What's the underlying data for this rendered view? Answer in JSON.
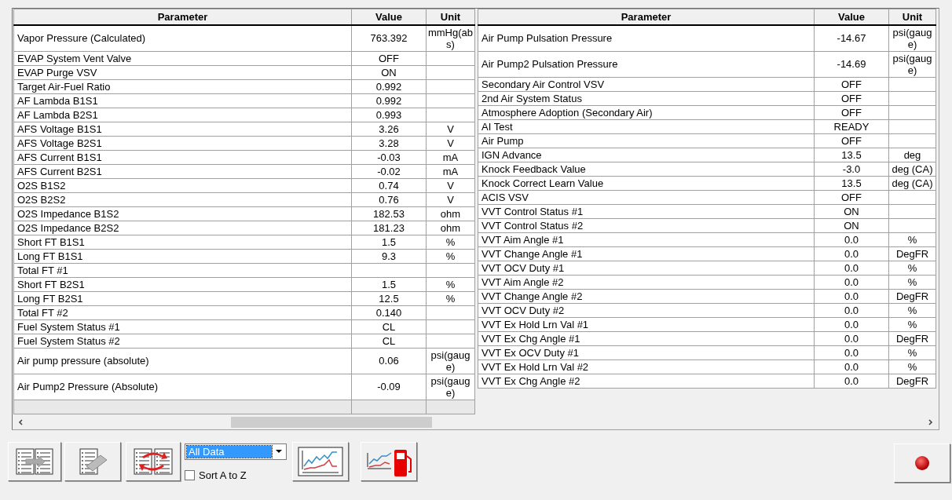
{
  "left_table": {
    "columns": [
      "Parameter",
      "Value",
      "Unit"
    ],
    "rows": [
      {
        "parameter": "Vapor Pressure (Calculated)",
        "value": "763.392",
        "unit": "mmHg(abs)"
      },
      {
        "parameter": "EVAP System Vent Valve",
        "value": "OFF"
      },
      {
        "parameter": "EVAP Purge VSV",
        "value": "ON"
      },
      {
        "parameter": "Target Air-Fuel Ratio",
        "value": "0.992"
      },
      {
        "parameter": "AF Lambda B1S1",
        "value": "0.992"
      },
      {
        "parameter": "AF Lambda B2S1",
        "value": "0.993"
      },
      {
        "parameter": "AFS Voltage B1S1",
        "value": "3.26",
        "unit": "V"
      },
      {
        "parameter": "AFS Voltage B2S1",
        "value": "3.28",
        "unit": "V"
      },
      {
        "parameter": "AFS Current B1S1",
        "value": "-0.03",
        "unit": "mA"
      },
      {
        "parameter": "AFS Current B2S1",
        "value": "-0.02",
        "unit": "mA"
      },
      {
        "parameter": "O2S B1S2",
        "value": "0.74",
        "unit": "V"
      },
      {
        "parameter": "O2S B2S2",
        "value": "0.76",
        "unit": "V"
      },
      {
        "parameter": "O2S Impedance B1S2",
        "value": "182.53",
        "unit": "ohm"
      },
      {
        "parameter": "O2S Impedance B2S2",
        "value": "181.23",
        "unit": "ohm"
      },
      {
        "parameter": "Short FT B1S1",
        "value": "1.5",
        "unit": "%"
      },
      {
        "parameter": "Long FT B1S1",
        "value": "9.3",
        "unit": "%"
      },
      {
        "parameter": "Total FT #1"
      },
      {
        "parameter": "Short FT B2S1",
        "value": "1.5",
        "unit": "%"
      },
      {
        "parameter": "Long FT B2S1",
        "value": "12.5",
        "unit": "%"
      },
      {
        "parameter": "Total FT #2",
        "value": "0.140"
      },
      {
        "parameter": "Fuel System Status #1",
        "value": "CL"
      },
      {
        "parameter": "Fuel System Status #2",
        "value": "CL"
      },
      {
        "parameter": "Air pump pressure (absolute)",
        "value": "0.06",
        "unit": "psi(gauge)"
      },
      {
        "parameter": "Air Pump2 Pressure (Absolute)",
        "value": "-0.09",
        "unit": "psi(gauge)"
      }
    ]
  },
  "right_table": {
    "columns": [
      "Parameter",
      "Value",
      "Unit"
    ],
    "rows": [
      {
        "parameter": "Air Pump Pulsation Pressure",
        "value": "-14.67",
        "unit": "psi(gauge)"
      },
      {
        "parameter": "Air Pump2 Pulsation Pressure",
        "value": "-14.69",
        "unit": "psi(gauge)"
      },
      {
        "parameter": "Secondary Air Control VSV",
        "value": "OFF"
      },
      {
        "parameter": "2nd Air System Status",
        "value": "OFF"
      },
      {
        "parameter": "Atmosphere Adoption (Secondary Air)",
        "value": "OFF"
      },
      {
        "parameter": "AI Test",
        "value": "READY"
      },
      {
        "parameter": "Air Pump",
        "value": "OFF"
      },
      {
        "parameter": "IGN Advance",
        "value": "13.5",
        "unit": "deg"
      },
      {
        "parameter": "Knock Feedback Value",
        "value": "-3.0",
        "unit": "deg (CA)"
      },
      {
        "parameter": "Knock Correct Learn Value",
        "value": "13.5",
        "unit": "deg (CA)"
      },
      {
        "parameter": "ACIS VSV",
        "value": "OFF"
      },
      {
        "parameter": "VVT Control Status #1",
        "value": "ON"
      },
      {
        "parameter": "VVT Control Status #2",
        "value": "ON"
      },
      {
        "parameter": "VVT Aim Angle #1",
        "value": "0.0",
        "unit": "%"
      },
      {
        "parameter": "VVT Change Angle #1",
        "value": "0.0",
        "unit": "DegFR"
      },
      {
        "parameter": "VVT OCV Duty #1",
        "value": "0.0",
        "unit": "%"
      },
      {
        "parameter": "VVT Aim Angle #2",
        "value": "0.0",
        "unit": "%"
      },
      {
        "parameter": "VVT Change Angle #2",
        "value": "0.0",
        "unit": "DegFR"
      },
      {
        "parameter": "VVT OCV Duty #2",
        "value": "0.0",
        "unit": "%"
      },
      {
        "parameter": "VVT Ex Hold Lrn Val #1",
        "value": "0.0",
        "unit": "%"
      },
      {
        "parameter": "VVT Ex Chg Angle #1",
        "value": "0.0",
        "unit": "DegFR"
      },
      {
        "parameter": "VVT Ex OCV Duty #1",
        "value": "0.0",
        "unit": "%"
      },
      {
        "parameter": "VVT Ex Hold Lrn Val #2",
        "value": "0.0",
        "unit": "%"
      },
      {
        "parameter": "VVT Ex Chg Angle #2",
        "value": "0.0",
        "unit": "DegFR"
      }
    ]
  },
  "toolbar": {
    "data_filter": {
      "value": "All Data"
    },
    "sort_a_to_z": {
      "label": "Sort A to Z",
      "checked": false
    }
  }
}
